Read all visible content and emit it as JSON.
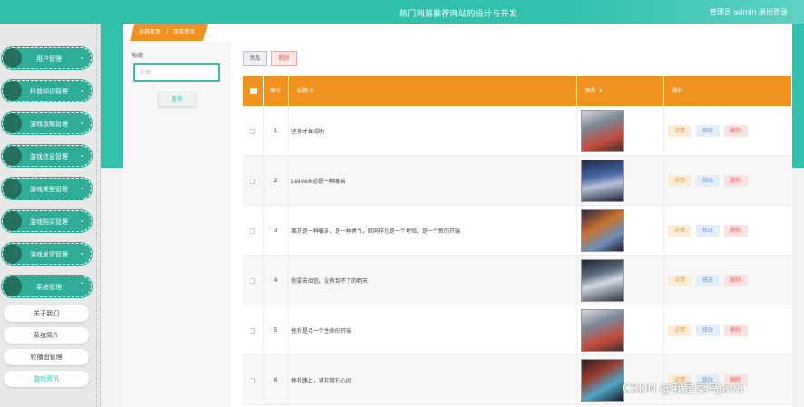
{
  "header": {
    "title": "热门网游推荐网站的设计与开发",
    "user_label": "管理员 admin",
    "logout_label": "退出登录"
  },
  "sidebar": {
    "items": [
      {
        "label": "用户管理",
        "icon": "chevron-down-icon"
      },
      {
        "label": "科普知识管理",
        "icon": "chevron-down-icon"
      },
      {
        "label": "游戏攻略管理",
        "icon": "chevron-down-icon"
      },
      {
        "label": "游戏信息管理",
        "icon": "chevron-down-icon"
      },
      {
        "label": "游戏类型管理",
        "icon": "chevron-down-icon"
      },
      {
        "label": "游戏购买管理",
        "icon": "chevron-down-icon"
      },
      {
        "label": "游戏发货管理",
        "icon": "chevron-down-icon"
      },
      {
        "label": "系统管理",
        "icon": "chevron-up-icon"
      }
    ],
    "sub_items": [
      {
        "label": "关于我们"
      },
      {
        "label": "系统简介"
      },
      {
        "label": "轮播图管理"
      },
      {
        "label": "游戏资讯",
        "active": true
      }
    ]
  },
  "breadcrumb": {
    "home": "系统首页",
    "separator": "/",
    "current": "游戏资讯"
  },
  "search": {
    "label": "标题",
    "placeholder": "标题",
    "query_label": "查询"
  },
  "toolbar": {
    "add_label": "添加",
    "delete_label": "删除"
  },
  "table": {
    "columns": [
      "",
      "索引",
      "标题",
      "图片",
      "操作"
    ],
    "sort_icon": "sort-icon",
    "rows": [
      {
        "index": "1",
        "title": "坚持才会成功"
      },
      {
        "index": "2",
        "title": "Leave未必是一种痛苦"
      },
      {
        "index": "3",
        "title": "离开是一种痛苦，是一种勇气，但同样也是一个考验，是一个新的开端"
      },
      {
        "index": "4",
        "title": "你要去相信，没有到不了的明天"
      },
      {
        "index": "5",
        "title": "挫折是另一个生命的开端"
      },
      {
        "index": "6",
        "title": "挫折路上，坚持常在心间"
      }
    ],
    "action_labels": {
      "detail": "详情",
      "edit": "修改",
      "remove": "删除"
    }
  },
  "watermark": "CSDN @我是菜鸟java",
  "colors": {
    "primary": "#2fc1ab",
    "accent": "#f0931e",
    "danger": "#e5534b"
  }
}
